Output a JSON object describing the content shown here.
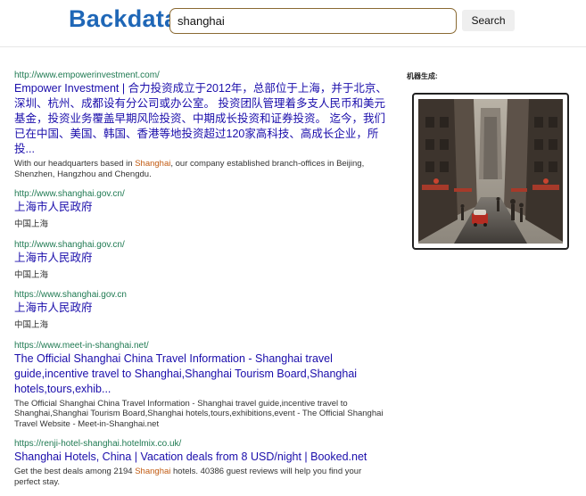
{
  "header": {
    "logo": "Backdata",
    "search_value": "shanghai",
    "search_button": "Search"
  },
  "results": [
    {
      "url": "http://www.empowerinvestment.com/",
      "title": "Empower Investment | 合力投资成立于2012年，总部位于上海，并于北京、深圳、杭州、成都设有分公司或办公室。 投资团队管理着多支人民币和美元基金，投资业务覆盖早期风险投资、中期成长投资和证券投资。 迄今，我们已在中国、美国、韩国、香港等地投资超过120家高科技、高成长企业，所投...",
      "snippet_before": "With our headquarters based in ",
      "snippet_highlight": "Shanghai",
      "snippet_after": ", our company established branch-offices in Beijing, Shenzhen, Hangzhou and Chengdu."
    },
    {
      "url": "http://www.shanghai.gov.cn/",
      "title": "上海市人民政府",
      "snippet": "中国上海"
    },
    {
      "url": "http://www.shanghai.gov.cn/",
      "title": "上海市人民政府",
      "snippet": "中国上海"
    },
    {
      "url": "https://www.shanghai.gov.cn",
      "title": "上海市人民政府",
      "snippet": "中国上海"
    },
    {
      "url": "https://www.meet-in-shanghai.net/",
      "title": "The Official Shanghai China Travel Information - Shanghai travel guide,incentive travel to Shanghai,Shanghai Tourism Board,Shanghai hotels,tours,exhib...",
      "snippet": "The Official Shanghai China Travel Information - Shanghai travel guide,incentive travel to Shanghai,Shanghai Tourism Board,Shanghai hotels,tours,exhibitions,event - The Official Shanghai Travel Website - Meet-in-Shanghai.net"
    },
    {
      "url": "https://renji-hotel-shanghai.hotelmix.co.uk/",
      "title": "Shanghai Hotels, China | Vacation deals from 8 USD/night | Booked.net",
      "snippet_before": "Get the best deals among 2194 ",
      "snippet_highlight": "Shanghai",
      "snippet_after": " hotels. 40386 guest reviews will help you find your perfect stay."
    }
  ],
  "sidebar": {
    "label": "机器生成:",
    "image_icon": "shanghai-street-image"
  },
  "colors": {
    "brand": "#1f67b7",
    "link": "#1a0dab",
    "url": "#1f7a52",
    "highlight": "#c25b12"
  }
}
